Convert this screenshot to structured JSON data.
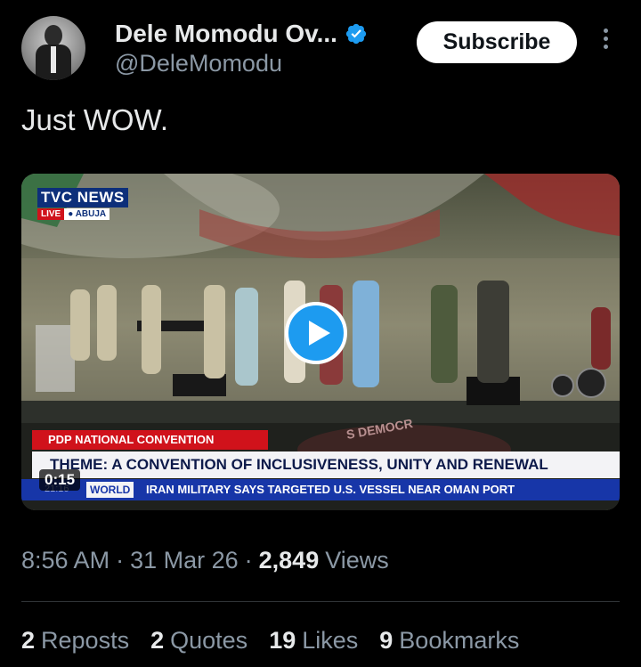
{
  "author": {
    "display_name": "Dele Momodu Ov...",
    "handle": "@DeleMomodu",
    "verified": true
  },
  "subscribe_label": "Subscribe",
  "tweet_text": "Just WOW.",
  "video": {
    "duration": "0:15",
    "overlay": {
      "channel": "TVC",
      "channel_suffix": "NEWS",
      "live": "LIVE",
      "location": "ABUJA",
      "banner": "PDP NATIONAL CONVENTION",
      "theme": "THEME: A CONVENTION OF INCLUSIVENESS, UNITY AND RENEWAL",
      "ticker_time": "21:16",
      "ticker_tag": "WORLD",
      "ticker_text": "IRAN MILITARY SAYS TARGETED U.S. VESSEL NEAR OMAN PORT",
      "backdrop_text": "S DEMOCR"
    }
  },
  "meta": {
    "time": "8:56 AM",
    "date": "31 Mar 26",
    "views_count": "2,849",
    "views_label": "Views"
  },
  "stats": {
    "reposts": {
      "count": "2",
      "label": "Reposts"
    },
    "quotes": {
      "count": "2",
      "label": "Quotes"
    },
    "likes": {
      "count": "19",
      "label": "Likes"
    },
    "bookmarks": {
      "count": "9",
      "label": "Bookmarks"
    }
  },
  "colors": {
    "background": "#000000",
    "accent": "#1d9bf0",
    "secondary_text": "#8b98a5",
    "tvc_red": "#d0121b",
    "tvc_blue": "#1736a8"
  },
  "icons": {
    "verified": "verified-badge-icon",
    "more": "more-vertical-icon",
    "play": "play-icon"
  }
}
